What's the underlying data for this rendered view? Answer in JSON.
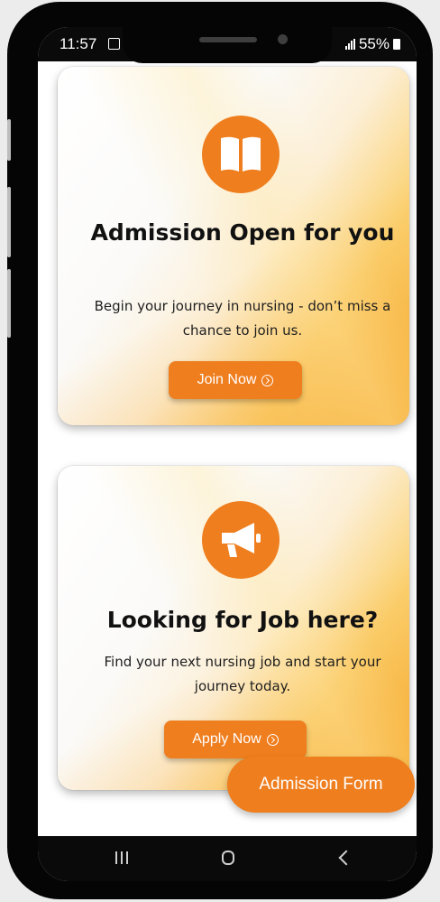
{
  "status_bar": {
    "time": "11:57",
    "battery": "55%"
  },
  "cards": [
    {
      "icon": "book-icon",
      "title": "Admission Open for you",
      "text": "Begin your journey in nursing - don’t miss a chance to join us.",
      "button_label": "Join Now"
    },
    {
      "icon": "megaphone-icon",
      "title": "Looking for Job here?",
      "text": "Find your next nursing job and start your journey today.",
      "button_label": "Apply Now"
    }
  ],
  "fab": {
    "label": "Admission Form"
  },
  "colors": {
    "accent": "#ef7e1e",
    "frame": "#050505"
  }
}
